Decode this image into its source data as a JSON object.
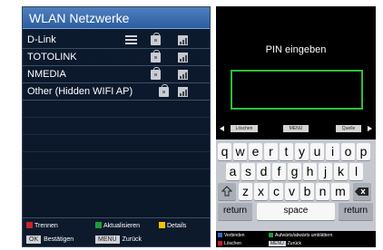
{
  "wlan": {
    "title": "WLAN Netzwerke",
    "networks": [
      {
        "name": "D-Link",
        "icons": [
          "link-icon",
          "lock-icon",
          "signal-icon"
        ]
      },
      {
        "name": "TOTOLINK",
        "icons": [
          "lock-icon",
          "signal-icon"
        ]
      },
      {
        "name": "NMEDIA",
        "icons": [
          "lock-icon",
          "signal-icon"
        ]
      },
      {
        "name": "Other (Hidden WIFI AP)",
        "icons": [
          "lock-icon",
          "signal-icon"
        ]
      }
    ],
    "footer": {
      "disconnect": {
        "label": "Trennen",
        "color": "#c8232c"
      },
      "refresh": {
        "label": "Aktualisieren",
        "color": "#1f9a3c"
      },
      "details": {
        "label": "Details",
        "color": "#f2c200"
      },
      "ok_key": "OK",
      "confirm": "Bestätigen",
      "menu_key": "MENU",
      "back": "Zurück"
    }
  },
  "pin": {
    "title": "PIN eingeben",
    "value": "",
    "bar": {
      "delete": "Löschen",
      "menu": "MENU",
      "source": "Quelle"
    },
    "keyboard": {
      "row1": [
        "q",
        "w",
        "e",
        "r",
        "t",
        "y",
        "u",
        "i",
        "o",
        "p"
      ],
      "row2": [
        "a",
        "s",
        "d",
        "f",
        "g",
        "h",
        "j",
        "k",
        "l"
      ],
      "row3": [
        "z",
        "x",
        "c",
        "v",
        "b",
        "n",
        "m"
      ],
      "return_left": "return",
      "space": "space",
      "return_right": "return"
    },
    "footer": {
      "connect": {
        "label": "Verbinden",
        "color": "#2a6fd0"
      },
      "page_updown": {
        "label": "Aufwärts/abwärts umblättern",
        "color": "#1f9a3c"
      },
      "delete": {
        "label": "Löschen",
        "color": "#c8232c"
      },
      "menu_key": "MENU",
      "back": "Zurück"
    }
  }
}
